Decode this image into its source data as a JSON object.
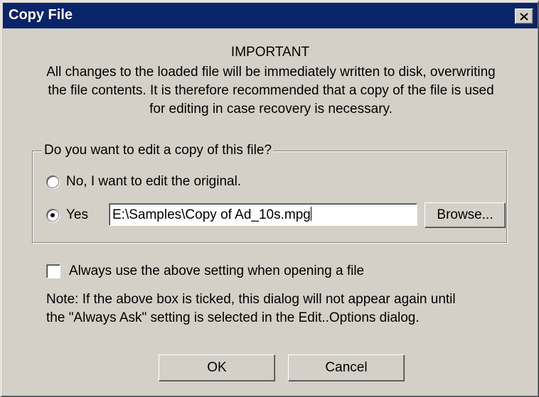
{
  "window": {
    "title": "Copy File",
    "close_icon": "close-icon"
  },
  "message": {
    "heading": "IMPORTANT",
    "line1": "All changes to the loaded file will be immediately written to disk, overwriting",
    "line2": "the file contents. It is therefore recommended that a copy of the file is used",
    "line3": "for editing in case recovery is necessary."
  },
  "group": {
    "legend": "Do you want to edit a copy of this file?",
    "option_no": {
      "label": "No, I want to edit the original.",
      "checked": false
    },
    "option_yes": {
      "label": "Yes",
      "checked": true
    },
    "path_value": "E:\\Samples\\Copy of Ad_10s.mpg",
    "browse_label": "Browse..."
  },
  "always": {
    "label": "Always use the above setting when opening a file",
    "checked": false
  },
  "note": {
    "line1": "Note: If the above box is ticked, this dialog will not appear again until",
    "line2": "the \"Always Ask\" setting is selected in the Edit..Options dialog."
  },
  "buttons": {
    "ok": "OK",
    "cancel": "Cancel"
  },
  "colors": {
    "titlebar": "#0a246a",
    "face": "#d4d0c8"
  }
}
